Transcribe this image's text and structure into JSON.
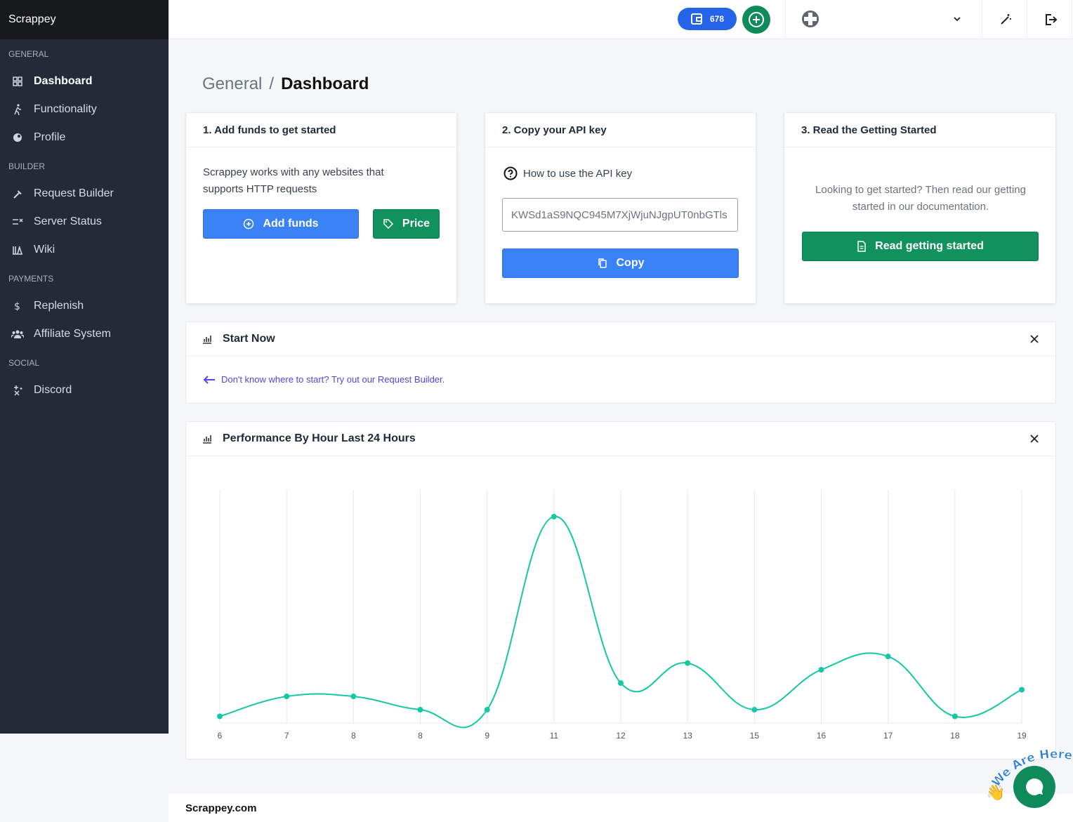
{
  "app": {
    "brand": "Scrappey"
  },
  "sidebar": {
    "sections": [
      {
        "label": "GENERAL",
        "items": [
          {
            "label": "Dashboard",
            "icon": "dashboard-grid-icon",
            "active": true
          },
          {
            "label": "Functionality",
            "icon": "walking-person-icon"
          },
          {
            "label": "Profile",
            "icon": "profile-circle-icon"
          }
        ]
      },
      {
        "label": "BUILDER",
        "items": [
          {
            "label": "Request Builder",
            "icon": "hammer-icon"
          },
          {
            "label": "Server Status",
            "icon": "status-lines-icon"
          },
          {
            "label": "Wiki",
            "icon": "books-icon"
          }
        ]
      },
      {
        "label": "PAYMENTS",
        "items": [
          {
            "label": "Replenish",
            "icon": "dollar-icon"
          },
          {
            "label": "Affiliate System",
            "icon": "users-icon"
          }
        ]
      },
      {
        "label": "SOCIAL",
        "items": [
          {
            "label": "Discord",
            "icon": "sparkles-icon"
          }
        ]
      }
    ]
  },
  "topbar": {
    "balance": "678",
    "icons": [
      "wallet-icon",
      "plus-circle-icon",
      "avatar-icon",
      "chevron-down-icon",
      "magic-wand-icon",
      "logout-icon"
    ]
  },
  "breadcrumb": {
    "parent": "General",
    "separator": "/",
    "current": "Dashboard"
  },
  "steps": {
    "funds": {
      "title": "1. Add funds to get started",
      "text": "Scrappey works with any websites that supports HTTP requests",
      "add_label": "Add funds",
      "price_label": "Price"
    },
    "api": {
      "title": "2. Copy your API key",
      "help": "How to use the API key",
      "key": "KWSd1aS9NQC945M7XjWjuNJgpUT0nbGTls",
      "copy_label": "Copy"
    },
    "guide": {
      "title": "3. Read the Getting Started",
      "text": "Looking to get started? Then read our getting started in our documentation.",
      "button_label": "Read getting started"
    }
  },
  "start_now": {
    "title": "Start Now",
    "link": "Don't know where to start? Try out our Request Builder."
  },
  "performance": {
    "title": "Performance By Hour Last 24 Hours"
  },
  "chart_data": {
    "type": "line",
    "title": "Performance By Hour Last 24 Hours",
    "categories": [
      "6",
      "7",
      "8",
      "8",
      "9",
      "11",
      "12",
      "13",
      "15",
      "16",
      "17",
      "18",
      "19"
    ],
    "values": [
      1,
      4,
      4,
      2,
      2,
      31,
      6,
      9,
      2,
      8,
      10,
      1,
      5
    ],
    "ylim": [
      0,
      35
    ],
    "grid": "vertical",
    "color": "#14c7a5",
    "smooth": true
  },
  "footer": {
    "text": "Scrappey.com"
  },
  "chat": {
    "badge_text": "We Are Here!"
  },
  "colors": {
    "sidebar": "#222b37",
    "primary": "#3b82f6",
    "success": "#10915e",
    "chart": "#14c7a5"
  }
}
